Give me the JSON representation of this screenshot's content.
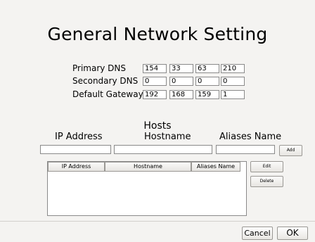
{
  "title": "General Network Setting",
  "dns": {
    "primary": {
      "label": "Primary DNS",
      "values": [
        "154",
        "33",
        "63",
        "210"
      ]
    },
    "secondary": {
      "label": "Secondary DNS",
      "values": [
        "0",
        "0",
        "0",
        "0"
      ]
    },
    "gateway": {
      "label": "Default Gateway",
      "values": [
        "192",
        "168",
        "159",
        "1"
      ]
    }
  },
  "hosts": {
    "title": "Hosts",
    "ip_label": "IP Address",
    "hostname_label": "Hostname",
    "aliases_label": "Aliases Name",
    "add_label": "Add",
    "edit_label": "Edit",
    "delete_label": "Delete",
    "table": {
      "columns": [
        "IP Address",
        "Hostname",
        "Aliases Name"
      ],
      "rows": []
    }
  },
  "footer": {
    "cancel_label": "Cancel",
    "ok_label": "OK"
  }
}
